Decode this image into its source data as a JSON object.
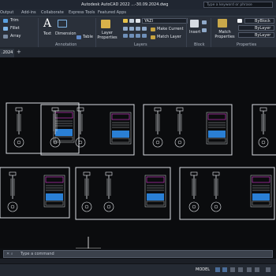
{
  "app": {
    "title": "Autodesk AutoCAD 2022   ...-30.09.2024.dwg",
    "search_placeholder": "Type a keyword or phrase"
  },
  "ribbon_tabs": [
    "Output",
    "Add-ins",
    "Collaborate",
    "Express Tools",
    "Featured Apps"
  ],
  "ribbon": {
    "modify": {
      "trim": "Trim",
      "fillet": "Fillet",
      "array": "Array"
    },
    "annotation": {
      "text": "Text",
      "dimension": "Dimension",
      "table": "Table",
      "label": "Annotation"
    },
    "layers": {
      "layer_properties": "Layer Properties",
      "current_layer": "YAZI",
      "make_current": "Make Current",
      "match_layer": "Match Layer",
      "label": "Layers"
    },
    "block": {
      "insert": "Insert",
      "label": "Block"
    },
    "properties": {
      "match_properties": "Match Properties",
      "color": "ByBlock",
      "linetype": "ByLayer",
      "lineweight": "ByLayer",
      "label": "Properties"
    }
  },
  "document": {
    "tab_label": ".2024",
    "new_tab": "+"
  },
  "command_line": {
    "placeholder": "Type a command"
  },
  "status": {
    "model": "MODEL"
  },
  "colors": {
    "accent": "#2a7fd4",
    "magenta": "#e03ad8",
    "canvas": "#0b0c0e"
  }
}
